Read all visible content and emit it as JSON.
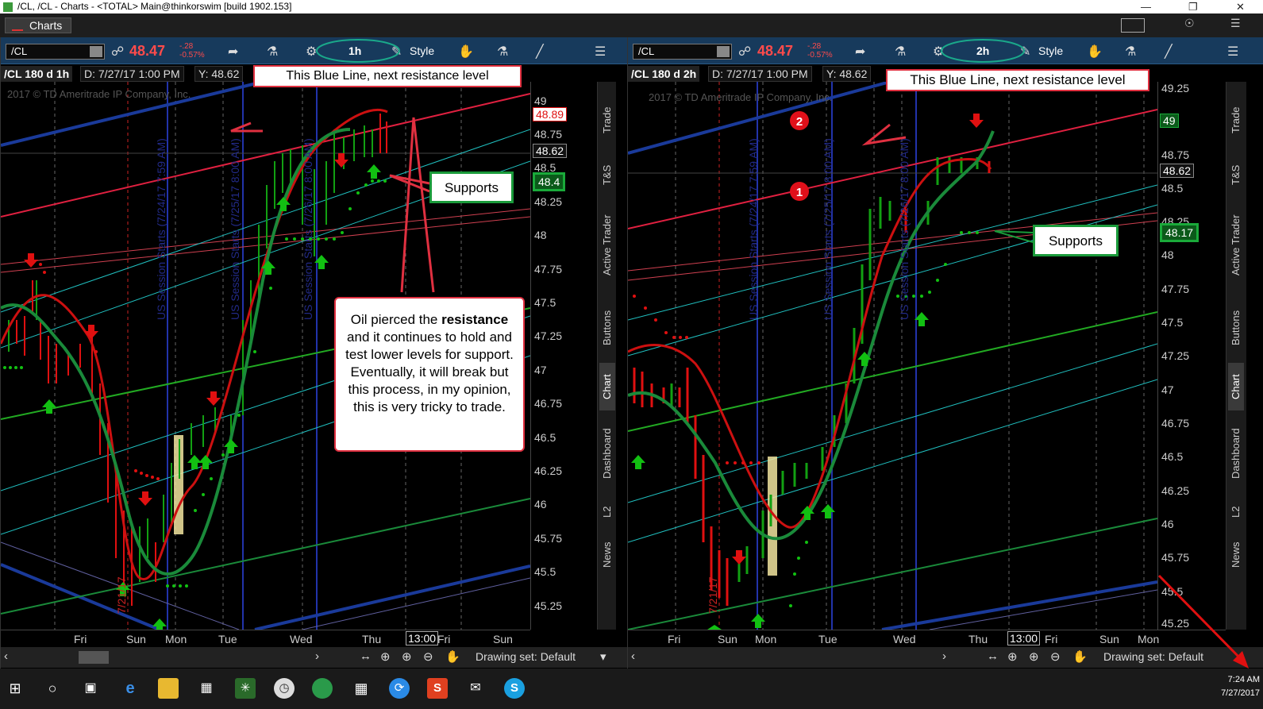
{
  "window": {
    "title": "/CL, /CL - Charts - <TOTAL> Main@thinkorswim [build 1902.153]"
  },
  "topbar": {
    "charts_tab": "Charts"
  },
  "left": {
    "symbol": "/CL",
    "price": "48.47",
    "change": "-.28",
    "change_pct": "-0.57%",
    "interval": "1h",
    "style_label": "Style",
    "chart_title": "/CL 180 d 1h",
    "date_field": "D: 7/27/17 1:00 PM",
    "y_field": "Y: 48.62",
    "copyright": "2017 © TD Ameritrade IP Company, Inc.",
    "callout_top": "This Blue Line, next resistance level",
    "callout_supports": "Supports",
    "note_pre": "Oil pierced the ",
    "note_bold": "resistance",
    "note_post": " and it continues to hold and test lower levels for support.  Eventually, it will break but this process, in my opinion, this is very tricky to trade.",
    "session_labels": [
      "US Session Starts (7/24/17 7:59 AM)",
      "US Session Starts (7/25/17 8:00 AM)",
      "US Session Starts (7/26/17 8:00 AM)"
    ],
    "date_marker": "7/21/17",
    "y_ticks": [
      "49",
      "48.75",
      "48.5",
      "48.25",
      "48",
      "47.75",
      "47.5",
      "47.25",
      "47",
      "46.75",
      "46.5",
      "46.25",
      "46",
      "45.75",
      "45.5",
      "45.25"
    ],
    "box_red": "48.89",
    "box_cur": "48.62",
    "box_green": "48.4",
    "x_ticks": [
      "Fri",
      "Sun",
      "Mon",
      "Tue",
      "Wed",
      "Thu",
      "Fri",
      "Sun"
    ],
    "x_box": "13:00",
    "drawing_set": "Drawing set: Default"
  },
  "right": {
    "symbol": "/CL",
    "price": "48.47",
    "change": "-.28",
    "change_pct": "-0.57%",
    "interval": "2h",
    "style_label": "Style",
    "chart_title": "/CL 180 d 2h",
    "date_field": "D: 7/27/17 1:00 PM",
    "y_field": "Y: 48.62",
    "copyright": "2017 © TD Ameritrade IP Company, Inc.",
    "callout_top": "This Blue Line, next resistance level",
    "callout_supports": "Supports",
    "marker_1": "1",
    "marker_2": "2",
    "session_labels": [
      "US Session Starts (7/24/17 7:59 AM)",
      "US Session Starts (7/25/17 8:00 AM)",
      "US Session Starts (7/26/17 8:00 AM)"
    ],
    "date_marker": "7/21/17",
    "y_ticks": [
      "49.25",
      "48.75",
      "48.5",
      "48.25",
      "48",
      "47.75",
      "47.5",
      "47.25",
      "47",
      "46.75",
      "46.5",
      "46.25",
      "46",
      "45.75",
      "45.5",
      "45.25"
    ],
    "box_green": "49",
    "box_cur": "48.62",
    "box_green2": "48.17",
    "x_ticks": [
      "Fri",
      "Sun",
      "Mon",
      "Tue",
      "Wed",
      "Thu",
      "Fri",
      "Sun",
      "Mon"
    ],
    "x_box": "13:00",
    "drawing_set": "Drawing set: Default"
  },
  "sidebar": {
    "tabs": [
      "Trade",
      "T&S",
      "Active Trader",
      "Buttons",
      "Chart",
      "Dashboard",
      "L2",
      "News"
    ]
  },
  "taskbar": {
    "time": "7:24 AM",
    "date": "7/27/2017"
  },
  "colors": {
    "toolbar": "#173a5c",
    "down": "#e01010",
    "up": "#12a012",
    "resistance_blue": "#1a3a9a",
    "callout_border": "#e03040",
    "support_border": "#1a9a3a"
  }
}
